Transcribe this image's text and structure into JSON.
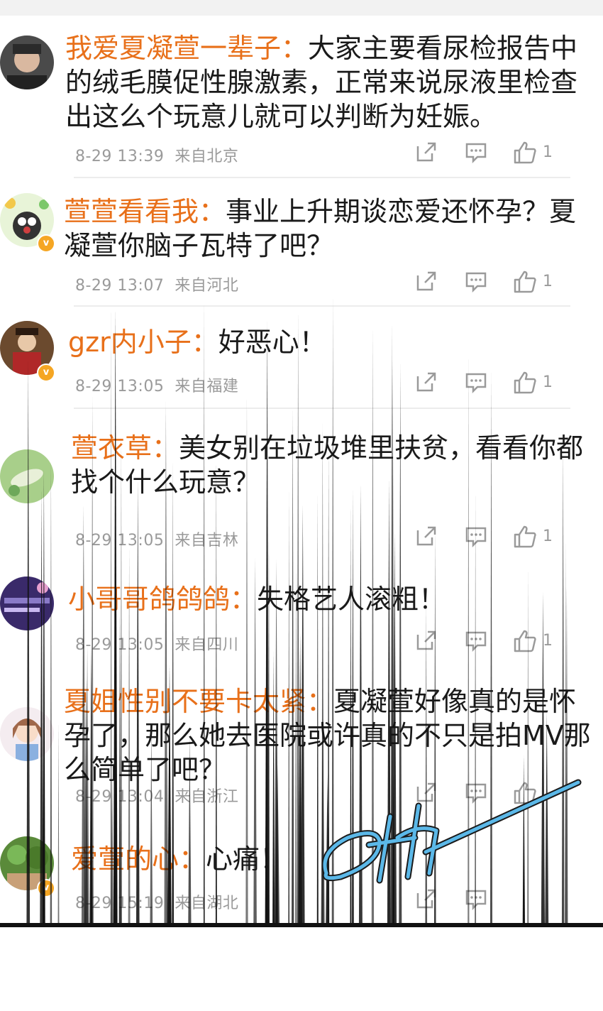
{
  "comments": [
    {
      "username": "我爱夏凝萱一辈子：",
      "text": "大家主要看尿检报告中的绒毛膜促性腺激素，正常来说尿液里检查出这么个玩意儿就可以判断为妊娠。",
      "line1_rest": "大家主要看尿检报告中",
      "line2": "的绒毛膜促性腺激素，正常来说尿液里检查",
      "line3": "出这么个玩意儿就可以判断为妊娠。",
      "time": "8-29 13:39",
      "source": "来自北京",
      "likes": "1",
      "verified": false,
      "avatar_icon": "man-portrait-avatar"
    },
    {
      "username": "萱萱看看我：",
      "line1_rest": "事业上升期谈恋爱还怀孕？夏",
      "line2": "凝萱你脑子瓦特了吧？",
      "time": "8-29 13:07",
      "source": "来自河北",
      "likes": "1",
      "verified": true,
      "avatar_icon": "cartoon-mole-avatar"
    },
    {
      "username": "gzr内小子：",
      "line1_rest": "好恶心！",
      "time": "8-29 13:05",
      "source": "来自福建",
      "likes": "1",
      "verified": true,
      "avatar_icon": "costume-woman-avatar"
    },
    {
      "username": "萱衣草：",
      "line1_rest": "美女别在垃圾堆里扶贫，看看你都",
      "line2": "找个什么玩意？",
      "time": "8-29 13:05",
      "source": "来自吉林",
      "likes": "1",
      "verified": false,
      "avatar_icon": "green-leaf-avatar"
    },
    {
      "username": "小哥哥鸽鸽鸽：",
      "line1_rest": "失格艺人滚粗！",
      "time": "8-29 13:05",
      "source": "来自四川",
      "likes": "1",
      "verified": false,
      "avatar_icon": "purple-poster-avatar"
    },
    {
      "username": "夏姐性别不要卡太紧：",
      "line1_rest": "夏凝萱好像真的是怀",
      "line2": "孕了，那么她去医院或许真的不只是拍MV那",
      "line3": "么简单了吧？",
      "time": "8-29 13:04",
      "source": "来自浙江",
      "likes": "",
      "verified": false,
      "avatar_icon": "anime-girl-avatar"
    },
    {
      "username": "爱萱的心：",
      "line1_rest": "心痛！",
      "time": "8-29 15:19",
      "source": "来自湖北",
      "likes": "",
      "verified": true,
      "avatar_icon": "green-garden-avatar"
    }
  ],
  "icons": {
    "share": "share-icon",
    "comment": "comment-icon",
    "like": "thumbs-up-icon",
    "verified": "verified-badge-icon"
  },
  "colors": {
    "username": "#e8701a",
    "meta": "#9a9a9a",
    "text": "#1a1a1a",
    "badge": "#f5a623",
    "signature": "#5bb8e8"
  }
}
